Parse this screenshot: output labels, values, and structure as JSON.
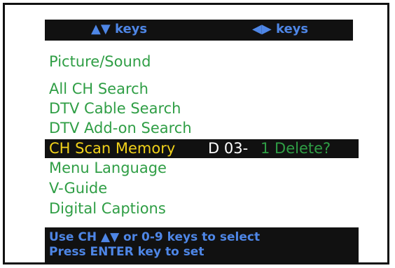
{
  "header": {
    "up_down_hint": "▲▼ keys",
    "left_right_hint": "◀▶ keys"
  },
  "menu": {
    "items": [
      {
        "label": "Picture/Sound"
      },
      {
        "label": "All CH Search"
      },
      {
        "label": "DTV Cable Search"
      },
      {
        "label": "DTV Add-on Search"
      },
      {
        "label": "CH Scan Memory",
        "channel": "D 03-",
        "action": "1 Delete?",
        "selected": true
      },
      {
        "label": "Menu Language"
      },
      {
        "label": "V-Guide"
      },
      {
        "label": "Digital Captions"
      }
    ]
  },
  "footer": {
    "line1": "Use CH ▲▼ or 0-9 keys to select",
    "line2": "Press ENTER key to set"
  },
  "colors": {
    "menu_text": "#2f9e45",
    "selected_text": "#f2d21a",
    "hint_text": "#4e86e6",
    "bar_background": "#111111"
  }
}
